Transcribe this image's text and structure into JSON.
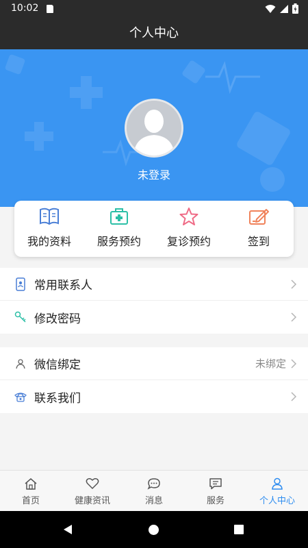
{
  "status_bar": {
    "time": "10:02"
  },
  "header": {
    "title": "个人中心"
  },
  "profile": {
    "login_status": "未登录"
  },
  "quick_actions": [
    {
      "label": "我的资料",
      "icon": "book-icon",
      "color": "#4a7fd6"
    },
    {
      "label": "服务预约",
      "icon": "medical-kit-icon",
      "color": "#2cbfa6"
    },
    {
      "label": "复诊预约",
      "icon": "star-icon",
      "color": "#ef6b86"
    },
    {
      "label": "签到",
      "icon": "checkin-icon",
      "color": "#f0825a"
    }
  ],
  "menu_group_1": [
    {
      "label": "常用联系人",
      "icon": "phone-contacts-icon"
    },
    {
      "label": "修改密码",
      "icon": "key-icon"
    }
  ],
  "menu_group_2": [
    {
      "label": "微信绑定",
      "value": "未绑定",
      "icon": "user-icon"
    },
    {
      "label": "联系我们",
      "icon": "telephone-icon"
    }
  ],
  "bottom_nav": [
    {
      "label": "首页",
      "icon": "home-icon"
    },
    {
      "label": "健康资讯",
      "icon": "heart-icon"
    },
    {
      "label": "消息",
      "icon": "chat-bubble-icon"
    },
    {
      "label": "服务",
      "icon": "message-square-icon"
    },
    {
      "label": "个人中心",
      "icon": "person-icon",
      "active": true
    }
  ],
  "colors": {
    "primary": "#3a95f2",
    "active_tab": "#2d8cf0",
    "status_bar": "#2b2b2b"
  }
}
